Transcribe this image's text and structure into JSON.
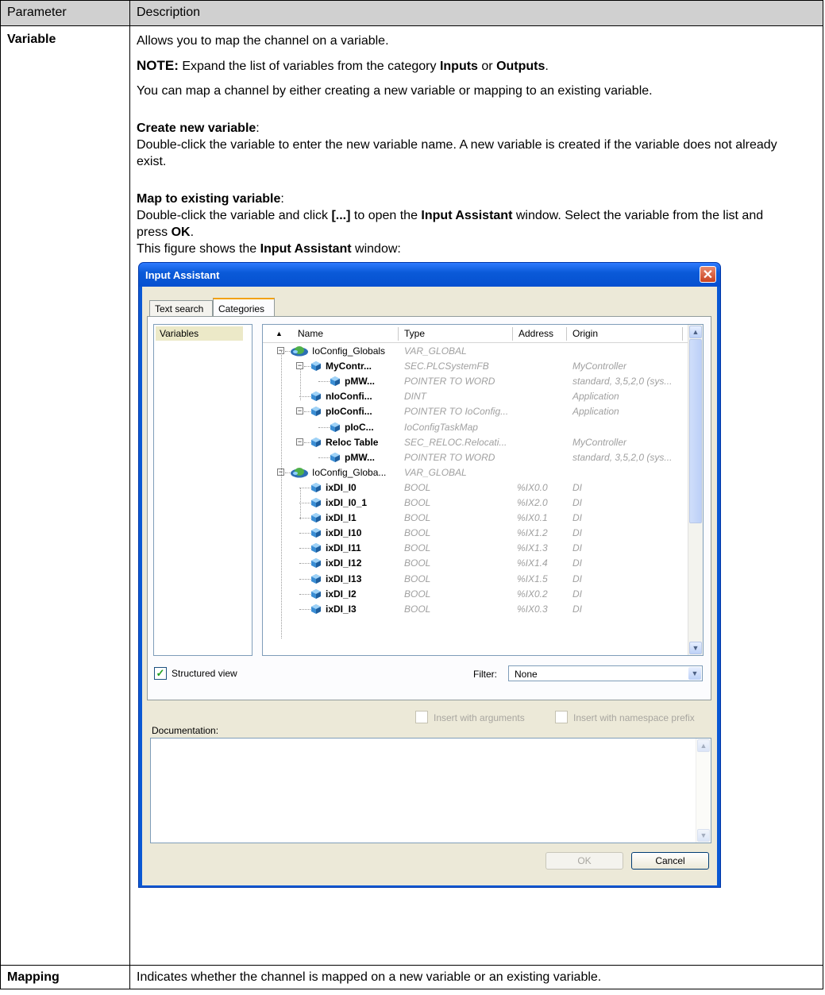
{
  "table": {
    "header_param": "Parameter",
    "header_desc": "Description",
    "row1": {
      "name": "Variable",
      "p1": "Allows you to map the channel on a variable.",
      "note_label": "NOTE:",
      "note_text": " Expand the list of variables from the category ",
      "note_inputs": "Inputs",
      "note_or": " or ",
      "note_outputs": "Outputs",
      "note_end": ".",
      "p3": "You can map a channel by either creating a new variable or mapping to an existing variable.",
      "create_heading": "Create new variable",
      "create_colon": ":",
      "create_text": "Double-click the variable to enter the new variable name. A new variable is created if the variable does not already exist.",
      "map_heading": "Map to existing variable",
      "map_colon": ":",
      "map_text_a": "Double-click the variable and click ",
      "map_dots": "[...]",
      "map_text_b": " to open the ",
      "map_ia": "Input Assistant",
      "map_text_c": " window. Select the variable from the list and press ",
      "map_ok": "OK",
      "map_end": ".",
      "fig_a": "This figure shows the ",
      "fig_ia": "Input Assistant",
      "fig_b": " window:"
    },
    "row2": {
      "name": "Mapping",
      "desc": "Indicates whether the channel is mapped on a new variable or an existing variable."
    }
  },
  "dialog": {
    "title": "Input Assistant",
    "close": "✕",
    "tabs": [
      "Text search",
      "Categories"
    ],
    "categories": [
      "Variables"
    ],
    "columns": {
      "sort": "▲",
      "name": "Name",
      "type": "Type",
      "address": "Address",
      "origin": "Origin"
    },
    "rows": [
      {
        "name": "IoConfig_Globals",
        "type": "VAR_GLOBAL",
        "address": "",
        "origin": ""
      },
      {
        "name": "MyContr...",
        "type": "SEC.PLCSystemFB",
        "address": "",
        "origin": "MyController"
      },
      {
        "name": "pMW...",
        "type": "POINTER TO WORD",
        "address": "",
        "origin": "standard, 3,5,2,0 (sys..."
      },
      {
        "name": "nIoConfi...",
        "type": "DINT",
        "address": "",
        "origin": "Application"
      },
      {
        "name": "pIoConfi...",
        "type": "POINTER TO IoConfig...",
        "address": "",
        "origin": "Application"
      },
      {
        "name": "pIoC...",
        "type": "IoConfigTaskMap",
        "address": "",
        "origin": ""
      },
      {
        "name": "Reloc Table",
        "type": "SEC_RELOC.Relocati...",
        "address": "",
        "origin": "MyController"
      },
      {
        "name": "pMW...",
        "type": "POINTER TO WORD",
        "address": "",
        "origin": "standard, 3,5,2,0 (sys..."
      },
      {
        "name": "IoConfig_Globa...",
        "type": "VAR_GLOBAL",
        "address": "",
        "origin": ""
      },
      {
        "name": "ixDI_I0",
        "type": "BOOL",
        "address": "%IX0.0",
        "origin": "DI"
      },
      {
        "name": "ixDI_I0_1",
        "type": "BOOL",
        "address": "%IX2.0",
        "origin": "DI"
      },
      {
        "name": "ixDI_I1",
        "type": "BOOL",
        "address": "%IX0.1",
        "origin": "DI"
      },
      {
        "name": "ixDI_I10",
        "type": "BOOL",
        "address": "%IX1.2",
        "origin": "DI"
      },
      {
        "name": "ixDI_I11",
        "type": "BOOL",
        "address": "%IX1.3",
        "origin": "DI"
      },
      {
        "name": "ixDI_I12",
        "type": "BOOL",
        "address": "%IX1.4",
        "origin": "DI"
      },
      {
        "name": "ixDI_I13",
        "type": "BOOL",
        "address": "%IX1.5",
        "origin": "DI"
      },
      {
        "name": "ixDI_I2",
        "type": "BOOL",
        "address": "%IX0.2",
        "origin": "DI"
      },
      {
        "name": "ixDI_I3",
        "type": "BOOL",
        "address": "%IX0.3",
        "origin": "DI"
      }
    ],
    "structured_view": "Structured view",
    "structured_checked": "✓",
    "filter_label": "Filter:",
    "filter_value": "None",
    "documentation_label": "Documentation:",
    "insert_args": "Insert with arguments",
    "insert_ns": "Insert with namespace prefix",
    "ok": "OK",
    "cancel": "Cancel",
    "arrow_up": "▲",
    "arrow_down": "▼"
  }
}
